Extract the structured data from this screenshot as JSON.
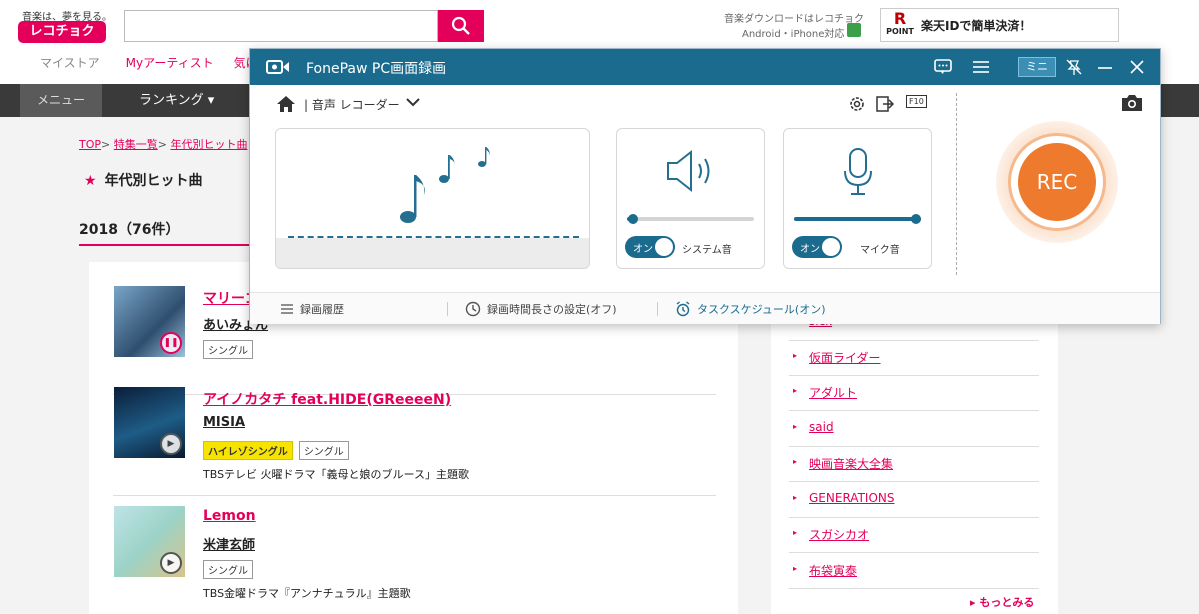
{
  "site": {
    "tagline": "音楽は、夢を見る。",
    "logo": "レコチョク",
    "download_text": "音楽ダウンロードはレコチョク",
    "download_sub": "Android・iPhone対応",
    "rakuten_r": "R",
    "rakuten_point": "POINT",
    "rakuten_text": "楽天IDで簡単決済！",
    "subnav": [
      "マイストア",
      "Myアーティスト",
      "気に"
    ],
    "gnav_menu": "メニュー",
    "gnav_ranking": "ランキング ▾",
    "gnav_cut": "ﾞ",
    "breadcrumb": [
      "TOP",
      "特集一覧",
      "年代別ヒット曲"
    ],
    "page_title": "年代別ヒット曲",
    "year_heading": "2018（76件）",
    "tracks": [
      {
        "title": "マリーゴールド",
        "artist": "あいみょん",
        "tags": [
          "シングル"
        ],
        "hires": "",
        "tie_in": ""
      },
      {
        "title": "アイノカタチ feat.HIDE(GReeeeN)",
        "artist": "MISIA",
        "tags": [
          "シングル"
        ],
        "hires": "ハイレゾシングル",
        "tie_in": "TBSテレビ 火曜ドラマ「義母と娘のブルース」主題歌"
      },
      {
        "title": "Lemon",
        "artist": "米津玄師",
        "tags": [
          "シングル"
        ],
        "hires": "",
        "tie_in": "TBS金曜ドラマ『アンナチュラル』主題歌"
      }
    ],
    "keywords": [
      "sick",
      "仮面ライダー",
      "アダルト",
      "said",
      "映画音楽大全集",
      "GENERATIONS",
      "スガシカオ",
      "布袋寅泰"
    ],
    "more": "▸ もっとみる"
  },
  "fonepaw": {
    "app_title": "FonePaw PC画面録画",
    "mini_label": "ミニ",
    "mode_label": "| 音声 レコーダー",
    "f10_label": "F10",
    "system_sound": {
      "toggle": "オン",
      "label": "システム音",
      "volume": 0.05
    },
    "mic": {
      "toggle": "オン",
      "label": "マイク音",
      "volume": 1.0
    },
    "rec_label": "REC",
    "footer": {
      "history": "録画履歴",
      "duration": "録画時間長さの設定(オフ)",
      "schedule": "タスクスケジュール(オン)"
    }
  },
  "colors": {
    "brand_pink": "#e4005a",
    "fp_blue": "#1b6b8e",
    "rec_orange": "#ee7a2e"
  }
}
